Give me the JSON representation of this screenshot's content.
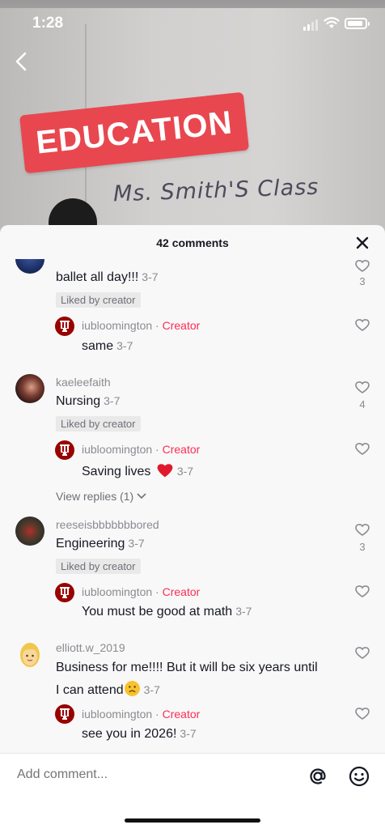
{
  "status": {
    "time": "1:28"
  },
  "video": {
    "sticker_text": "EDUCATION",
    "board_text": "Ms. Smith'S Class"
  },
  "sheet": {
    "title": "42 comments"
  },
  "comments": [
    {
      "username": "",
      "text": "ballet all day!!!",
      "date": "3-7",
      "liked_by_creator": "Liked by creator",
      "likes": "3",
      "reply": {
        "username": "iubloomington",
        "sep": " · ",
        "creator": "Creator",
        "text": "same",
        "date": "3-7"
      }
    },
    {
      "username": "kaeleefaith",
      "text": "Nursing",
      "date": "3-7",
      "liked_by_creator": "Liked by creator",
      "likes": "4",
      "reply": {
        "username": "iubloomington",
        "sep": " · ",
        "creator": "Creator",
        "text": "Saving lives ",
        "date": "3-7"
      },
      "view_replies": "View replies (1)"
    },
    {
      "username": "reeseisbbbbbbbored",
      "text": "Engineering",
      "date": "3-7",
      "liked_by_creator": "Liked by creator",
      "likes": "3",
      "reply": {
        "username": "iubloomington",
        "sep": " · ",
        "creator": "Creator",
        "text": "You must be good at math",
        "date": "3-7"
      }
    },
    {
      "username": "elliott.w_2019",
      "text_line1": "Business for me!!!! But it will be six years until",
      "text_line2": "I can attend",
      "date": "3-7",
      "reply": {
        "username": "iubloomington",
        "sep": " · ",
        "creator": "Creator",
        "text": "see you in 2026!",
        "date": "3-7"
      }
    }
  ],
  "input": {
    "placeholder": "Add comment..."
  },
  "colors": {
    "accent": "#fe2c55",
    "iu_red": "#990000",
    "sticker": "#e8474f"
  }
}
